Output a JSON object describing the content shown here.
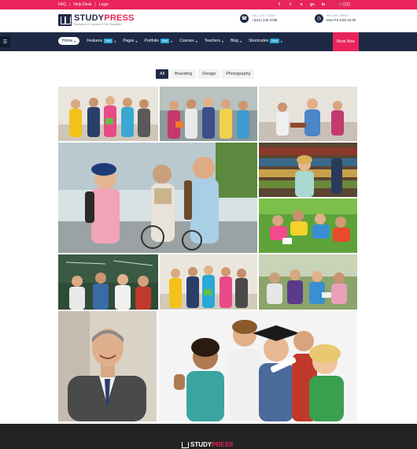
{
  "topbar": {
    "links": [
      "FAQ",
      "Help Desk",
      "Login"
    ],
    "social_icons": [
      "facebook-icon",
      "twitter-icon",
      "vimeo-icon",
      "google-plus-icon",
      "linkedin-icon"
    ],
    "social_glyphs": [
      "f",
      "t",
      "v",
      "g+",
      "in"
    ],
    "cart": "(12)",
    "color": "#e8245a"
  },
  "header": {
    "logo_name_a": "STUDY",
    "logo_name_b": "PRESS",
    "logo_tagline": "Education & Courses HTML Template",
    "call_label": "CALL US TODAY!",
    "call_value": "+(012) 345 6789",
    "open_label": "WE ARE OPEN!",
    "open_value": "Mon-Fri 8:00-16:00"
  },
  "nav": {
    "items": [
      {
        "label": "Home",
        "badge": "",
        "active": true
      },
      {
        "label": "Features",
        "badge": "New"
      },
      {
        "label": "Pages",
        "badge": ""
      },
      {
        "label": "Portfolio",
        "badge": "New"
      },
      {
        "label": "Courses",
        "badge": ""
      },
      {
        "label": "Teachers",
        "badge": ""
      },
      {
        "label": "Blog",
        "badge": ""
      },
      {
        "label": "Shortcodes",
        "badge": "New"
      }
    ],
    "book_label": "Book Now",
    "background": "#1e2a45"
  },
  "filters": [
    "All",
    "Branding",
    "Design",
    "Photography"
  ],
  "footer": {
    "logo_name_a": "STUDY",
    "logo_name_b": "PRESS"
  }
}
